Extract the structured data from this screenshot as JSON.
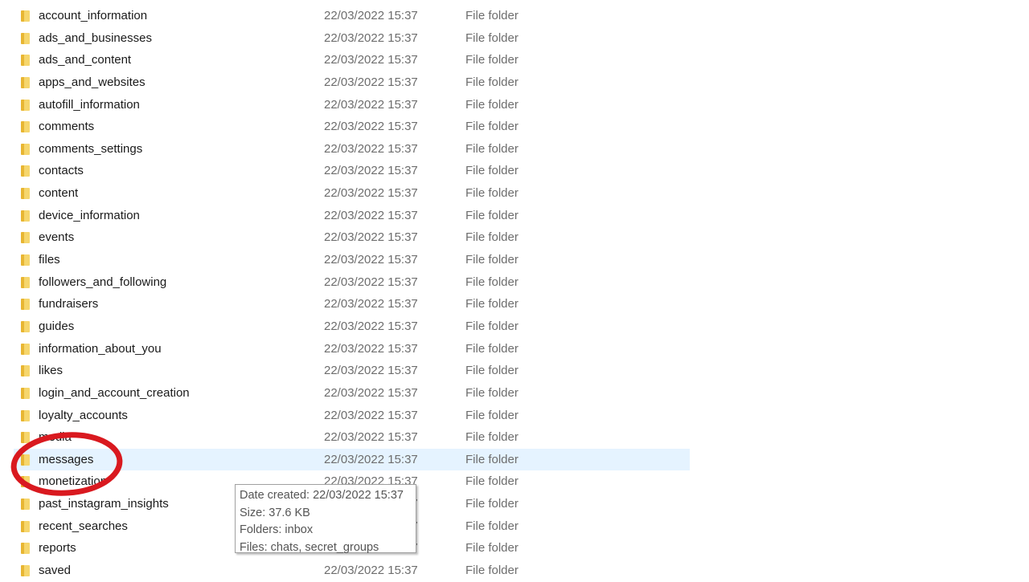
{
  "files": [
    {
      "name": "account_information",
      "date": "22/03/2022 15:37",
      "type": "File folder"
    },
    {
      "name": "ads_and_businesses",
      "date": "22/03/2022 15:37",
      "type": "File folder"
    },
    {
      "name": "ads_and_content",
      "date": "22/03/2022 15:37",
      "type": "File folder"
    },
    {
      "name": "apps_and_websites",
      "date": "22/03/2022 15:37",
      "type": "File folder"
    },
    {
      "name": "autofill_information",
      "date": "22/03/2022 15:37",
      "type": "File folder"
    },
    {
      "name": "comments",
      "date": "22/03/2022 15:37",
      "type": "File folder"
    },
    {
      "name": "comments_settings",
      "date": "22/03/2022 15:37",
      "type": "File folder"
    },
    {
      "name": "contacts",
      "date": "22/03/2022 15:37",
      "type": "File folder"
    },
    {
      "name": "content",
      "date": "22/03/2022 15:37",
      "type": "File folder"
    },
    {
      "name": "device_information",
      "date": "22/03/2022 15:37",
      "type": "File folder"
    },
    {
      "name": "events",
      "date": "22/03/2022 15:37",
      "type": "File folder"
    },
    {
      "name": "files",
      "date": "22/03/2022 15:37",
      "type": "File folder"
    },
    {
      "name": "followers_and_following",
      "date": "22/03/2022 15:37",
      "type": "File folder"
    },
    {
      "name": "fundraisers",
      "date": "22/03/2022 15:37",
      "type": "File folder"
    },
    {
      "name": "guides",
      "date": "22/03/2022 15:37",
      "type": "File folder"
    },
    {
      "name": "information_about_you",
      "date": "22/03/2022 15:37",
      "type": "File folder"
    },
    {
      "name": "likes",
      "date": "22/03/2022 15:37",
      "type": "File folder"
    },
    {
      "name": "login_and_account_creation",
      "date": "22/03/2022 15:37",
      "type": "File folder"
    },
    {
      "name": "loyalty_accounts",
      "date": "22/03/2022 15:37",
      "type": "File folder"
    },
    {
      "name": "media",
      "date": "22/03/2022 15:37",
      "type": "File folder"
    },
    {
      "name": "messages",
      "date": "22/03/2022 15:37",
      "type": "File folder"
    },
    {
      "name": "monetization",
      "date": "22/03/2022 15:37",
      "type": "File folder"
    },
    {
      "name": "past_instagram_insights",
      "date": "22/03/2022 15:37",
      "type": "File folder"
    },
    {
      "name": "recent_searches",
      "date": "22/03/2022 15:37",
      "type": "File folder"
    },
    {
      "name": "reports",
      "date": "22/03/2022 15:37",
      "type": "File folder"
    },
    {
      "name": "saved",
      "date": "22/03/2022 15:37",
      "type": "File folder"
    }
  ],
  "selected_index": 20,
  "tooltip": {
    "date_created": "Date created: 22/03/2022 15:37",
    "size": "Size: 37.6 KB",
    "folders": "Folders: inbox",
    "files": "Files: chats, secret_groups"
  },
  "colors": {
    "highlight": "#e5f3ff",
    "annotation": "#d9191f",
    "folder": "#f6d66c"
  }
}
